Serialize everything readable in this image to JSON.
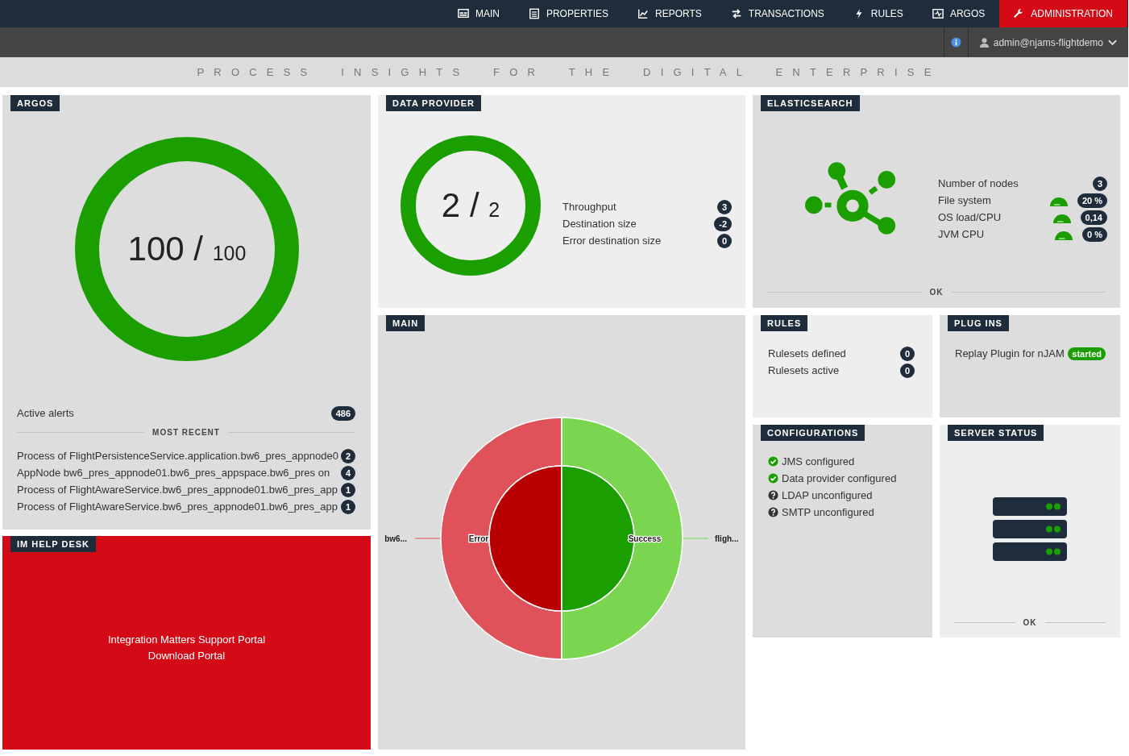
{
  "nav": {
    "items": [
      {
        "label": "MAIN",
        "selected": false
      },
      {
        "label": "PROPERTIES",
        "selected": false
      },
      {
        "label": "REPORTS",
        "selected": false
      },
      {
        "label": "TRANSACTIONS",
        "selected": false
      },
      {
        "label": "RULES",
        "selected": false
      },
      {
        "label": "ARGOS",
        "selected": false
      },
      {
        "label": "ADMINISTRATION",
        "selected": true
      }
    ]
  },
  "user_bar": {
    "user": "admin@njams-flightdemo"
  },
  "tagline": "PROCESS INSIGHTS FOR THE DIGITAL ENTERPRISE",
  "argos": {
    "title": "ARGOS",
    "ring": {
      "level": 1,
      "value": "100",
      "separator": "/",
      "total": "100"
    },
    "active_alerts": {
      "label": "Active alerts",
      "count": "486"
    },
    "recent_heading": "MOST RECENT",
    "recent": [
      {
        "text": "Process of FlightPersistenceService.application.bw6_pres_appnode0",
        "count": "2"
      },
      {
        "text": "AppNode bw6_pres_appnode01.bw6_pres_appspace.bw6_pres on",
        "count": "4"
      },
      {
        "text": "Process of FlightAwareService.bw6_pres_appnode01.bw6_pres_app",
        "count": "1"
      },
      {
        "text": "Process of FlightAwareService.bw6_pres_appnode01.bw6_pres_app",
        "count": "1"
      }
    ]
  },
  "help_desk": {
    "title": "IM HELP DESK",
    "links": [
      "Integration Matters Support Portal",
      "Download Portal"
    ]
  },
  "data_provider": {
    "title": "DATA PROVIDER",
    "ring": {
      "level": 1,
      "value": "2",
      "separator": "/",
      "total": "2"
    },
    "metrics": [
      {
        "label": "Throughput",
        "value": "3"
      },
      {
        "label": "Destination size",
        "value": "-2"
      },
      {
        "label": "Error destination size",
        "value": "0"
      }
    ]
  },
  "elasticsearch": {
    "title": "ELASTICSEARCH",
    "metrics": [
      {
        "label": "Number of nodes",
        "value": "3",
        "kind": "count"
      },
      {
        "label": "File system",
        "value": "20 %",
        "kind": "gauge"
      },
      {
        "label": "OS load/CPU",
        "value": "0,14",
        "kind": "gauge"
      },
      {
        "label": "JVM CPU",
        "value": "0 %",
        "kind": "gauge"
      }
    ],
    "status": "OK"
  },
  "main": {
    "title": "MAIN",
    "sunburst": [
      {
        "label": "Error",
        "color": "#b80000",
        "outer": {
          "label": "bw6...",
          "color": "#e0525a"
        }
      },
      {
        "label": "Success",
        "color": "#1a9e00",
        "outer": {
          "label": "fligh...",
          "color": "#7ad650"
        }
      }
    ]
  },
  "rules": {
    "title": "RULES",
    "metrics": [
      {
        "label": "Rulesets defined",
        "value": "0"
      },
      {
        "label": "Rulesets active",
        "value": "0"
      }
    ]
  },
  "plugins": {
    "title": "PLUG INS",
    "items": [
      {
        "name": "Replay Plugin for nJAM",
        "status": "started"
      }
    ]
  },
  "configurations": {
    "title": "CONFIGURATIONS",
    "items": [
      {
        "label": "JMS configured",
        "configured": true
      },
      {
        "label": "Data provider configured",
        "configured": true
      },
      {
        "label": "LDAP unconfigured",
        "configured": false
      },
      {
        "label": "SMTP unconfigured",
        "configured": false
      }
    ]
  },
  "server_status": {
    "title": "SERVER STATUS",
    "status": "OK"
  }
}
